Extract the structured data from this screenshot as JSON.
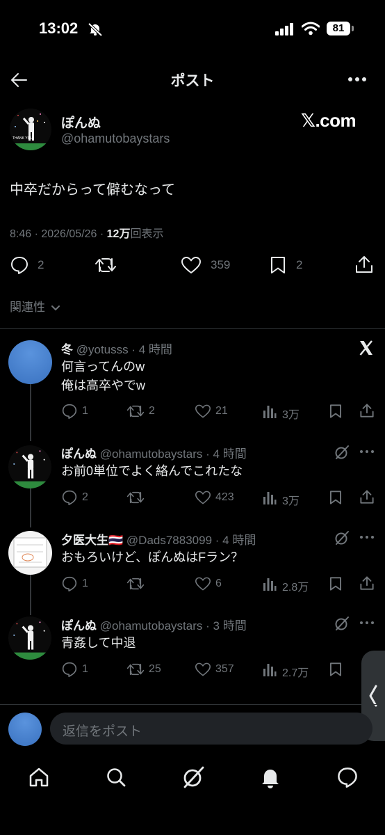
{
  "status_bar": {
    "time": "13:02",
    "battery": "81"
  },
  "header": {
    "title": "ポスト"
  },
  "post": {
    "author_name": "ぽんぬ",
    "author_handle": "@ohamutobaystars",
    "avatar_text": "THANK YOU",
    "source_badge": "𝕏.com",
    "text": "中卒だからって僻むなって",
    "timestamp": "8:46 · 2026/05/26 · ",
    "views": "12万",
    "views_suffix": "回表示",
    "replies": "2",
    "likes": "359",
    "bookmarks": "2"
  },
  "sort_label": "関連性",
  "replies": [
    {
      "name": "冬",
      "handle": "@yotusss",
      "time": "· 4 時間",
      "lines": [
        "何言ってんのw",
        "俺は高卒やでw"
      ],
      "replies": "1",
      "reposts": "2",
      "likes": "21",
      "views": "3万"
    },
    {
      "name": "ぽんぬ",
      "handle": "@ohamutobaystars",
      "time": "· 4 時間",
      "lines": [
        "お前0単位でよく絡んでこれたな"
      ],
      "replies": "2",
      "reposts": "",
      "likes": "423",
      "views": "3万"
    },
    {
      "name": "夕医大生🇹🇭",
      "handle": "@Dads7883099",
      "time": "· 4 時間",
      "lines": [
        "おもろいけど、ぽんぬはFラン？"
      ],
      "replies": "1",
      "reposts": "",
      "likes": "6",
      "views": "2.8万"
    },
    {
      "name": "ぽんぬ",
      "handle": "@ohamutobaystars",
      "time": "· 3 時間",
      "lines": [
        "青姦して中退"
      ],
      "replies": "1",
      "reposts": "25",
      "likes": "357",
      "views": "2.7万"
    }
  ],
  "compose": {
    "placeholder": "返信をポスト"
  },
  "colors": {
    "background": "#000000",
    "text": "#e7e9ea",
    "muted": "#71767b",
    "divider": "#2f3336",
    "avatar_blue": "#4a86d4"
  }
}
